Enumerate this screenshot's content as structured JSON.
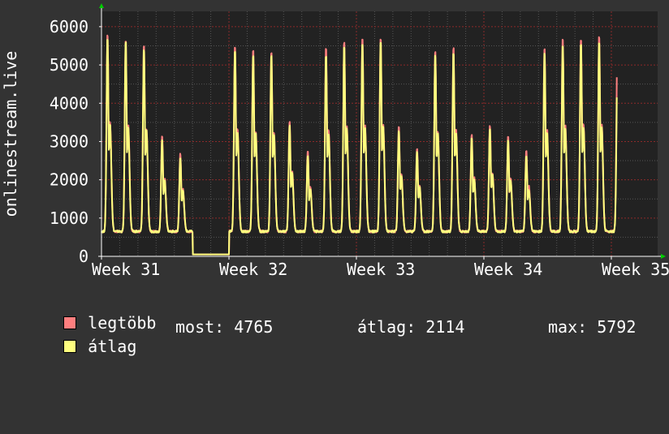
{
  "chart_data": {
    "type": "line",
    "ylabel": "onlinestream.live",
    "xlabel": "",
    "ylim": [
      0,
      6400
    ],
    "y_ticks": [
      "0",
      "1000",
      "2000",
      "3000",
      "4000",
      "5000",
      "6000"
    ],
    "x_ticks": [
      "Week 31",
      "Week 32",
      "Week 33",
      "Week 34",
      "Week 35"
    ],
    "grid": true,
    "x_days": 28.3,
    "series": [
      {
        "name": "legtöbb",
        "color": "#ff7f7f",
        "daily_peaks": [
          5850,
          5700,
          5550,
          3150,
          2700,
          50,
          50,
          5550,
          5450,
          5400,
          3550,
          2800,
          5500,
          5650,
          5750,
          5750,
          3400,
          2850,
          5400,
          5500,
          3200,
          3450,
          3150,
          2800,
          5500,
          5750,
          5750,
          5800,
          5400
        ]
      },
      {
        "name": "átlag",
        "color": "#ffff7f",
        "daily_peaks": [
          5750,
          5650,
          5450,
          3050,
          2600,
          50,
          50,
          5400,
          5300,
          5300,
          3450,
          2650,
          5300,
          5550,
          5600,
          5650,
          3300,
          2750,
          5300,
          5350,
          3100,
          3350,
          3050,
          2650,
          5350,
          5550,
          5600,
          5650,
          4765
        ]
      }
    ]
  },
  "legend": {
    "series1_label": "legtöbb",
    "series2_label": "átlag",
    "now_label": "most:",
    "now_value": "4765",
    "avg_label": "átlag:",
    "avg_value": "2114",
    "max_label": "max:",
    "max_value": "5792"
  },
  "colors": {
    "background": "#333333",
    "plot_background": "#222222",
    "grid_major": "#8b2a2a",
    "grid_minor": "#555555",
    "arrow": "#00cc00"
  }
}
